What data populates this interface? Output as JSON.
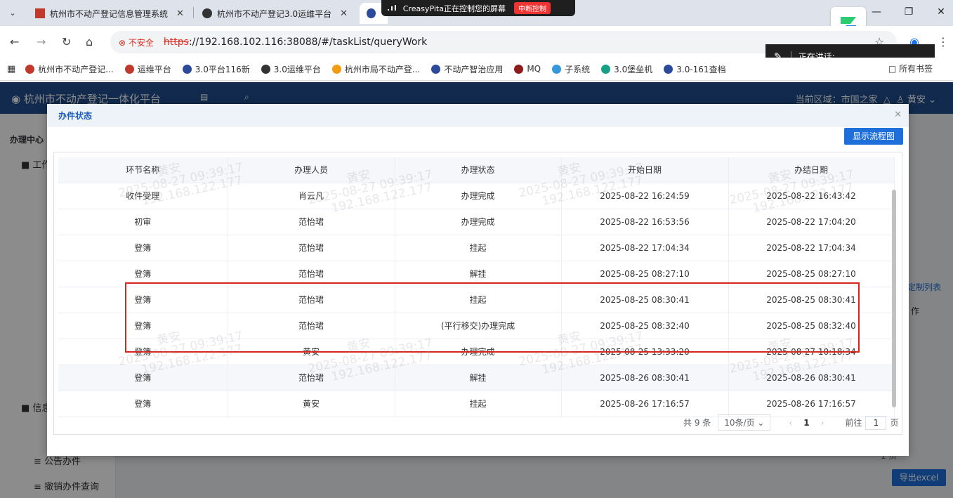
{
  "browser": {
    "tabs": [
      {
        "title": "杭州市不动产登记信息管理系统",
        "active": false
      },
      {
        "title": "杭州市不动产登记3.0运维平台",
        "active": false
      },
      {
        "title": "",
        "active": true
      }
    ],
    "close_symbol": "✕",
    "share_banner": {
      "text": "CreasyPita正在控制您的屏幕",
      "stop_label": "中断控制"
    },
    "address": {
      "security_label": "不安全",
      "scheme": "https",
      "rest": "://192.168.102.116:38088/#/taskList/queryWork"
    },
    "speaking_label": "正在讲话:",
    "bookmarks": [
      {
        "label": "杭州市不动产登记...",
        "icon_color": "#c0392b"
      },
      {
        "label": "运维平台",
        "icon_color": "#c0392b"
      },
      {
        "label": "3.0平台116新",
        "icon_color": "#2c4a9a"
      },
      {
        "label": "3.0运维平台",
        "icon_color": "#333333"
      },
      {
        "label": "杭州市局不动产登...",
        "icon_color": "#f39c12"
      },
      {
        "label": "不动产智治应用",
        "icon_color": "#2c4a9a"
      },
      {
        "label": "MQ",
        "icon_color": "#8e1b1b"
      },
      {
        "label": "子系统",
        "icon_color": "#3498db"
      },
      {
        "label": "3.0堡垒机",
        "icon_color": "#16a085"
      },
      {
        "label": "3.0-161查档",
        "icon_color": "#2c4a9a"
      }
    ],
    "bookmarks_right": "所有书签"
  },
  "app": {
    "title": "杭州市不动产登记一体化平台",
    "region": "当前区域：市国之家",
    "user": "黄安",
    "sidebar_section": "办理中心",
    "sidebar_items": [
      "工作",
      "信息",
      "公告办件",
      "撤销办件查询"
    ],
    "bg_pager_page": "1",
    "bg_pager_unit": "页",
    "export_label": "导出excel",
    "custom_list_label": "定制列表",
    "op_label": "作"
  },
  "dialog": {
    "title": "办件状态",
    "flow_button": "显示流程图",
    "columns": [
      "环节名称",
      "办理人员",
      "办理状态",
      "开始日期",
      "办结日期"
    ],
    "rows": [
      [
        "收件受理",
        "肖云凡",
        "办理完成",
        "2025-08-22 16:24:59",
        "2025-08-22 16:43:42"
      ],
      [
        "初审",
        "范怡珺",
        "办理完成",
        "2025-08-22 16:53:56",
        "2025-08-22 17:04:20"
      ],
      [
        "登簿",
        "范怡珺",
        "挂起",
        "2025-08-22 17:04:34",
        "2025-08-22 17:04:34"
      ],
      [
        "登簿",
        "范怡珺",
        "解挂",
        "2025-08-25 08:27:10",
        "2025-08-25 08:27:10"
      ],
      [
        "登簿",
        "范怡珺",
        "挂起",
        "2025-08-25 08:30:41",
        "2025-08-25 08:30:41"
      ],
      [
        "登簿",
        "范怡珺",
        "(平行移交)办理完成",
        "2025-08-25 08:32:40",
        "2025-08-25 08:32:40"
      ],
      [
        "登簿",
        "黄安",
        "办理完成",
        "2025-08-25 13:33:20",
        "2025-08-27 10:18:34"
      ],
      [
        "登簿",
        "范怡珺",
        "解挂",
        "2025-08-26 08:30:41",
        "2025-08-26 08:30:41"
      ],
      [
        "登簿",
        "黄安",
        "挂起",
        "2025-08-26 17:16:57",
        "2025-08-26 17:16:57"
      ]
    ],
    "pager": {
      "total": "共 9 条",
      "page_size": "10条/页",
      "current": "1",
      "goto_prefix": "前往",
      "goto_value": "1",
      "goto_suffix": "页"
    },
    "watermark": {
      "user": "黄安",
      "time": "2025-08-27 09:39:17",
      "ip": "192.168.122.177"
    }
  },
  "colors": {
    "brand": "#1f4e8c",
    "primary": "#1e6fd9",
    "highlight": "#d9261c"
  }
}
